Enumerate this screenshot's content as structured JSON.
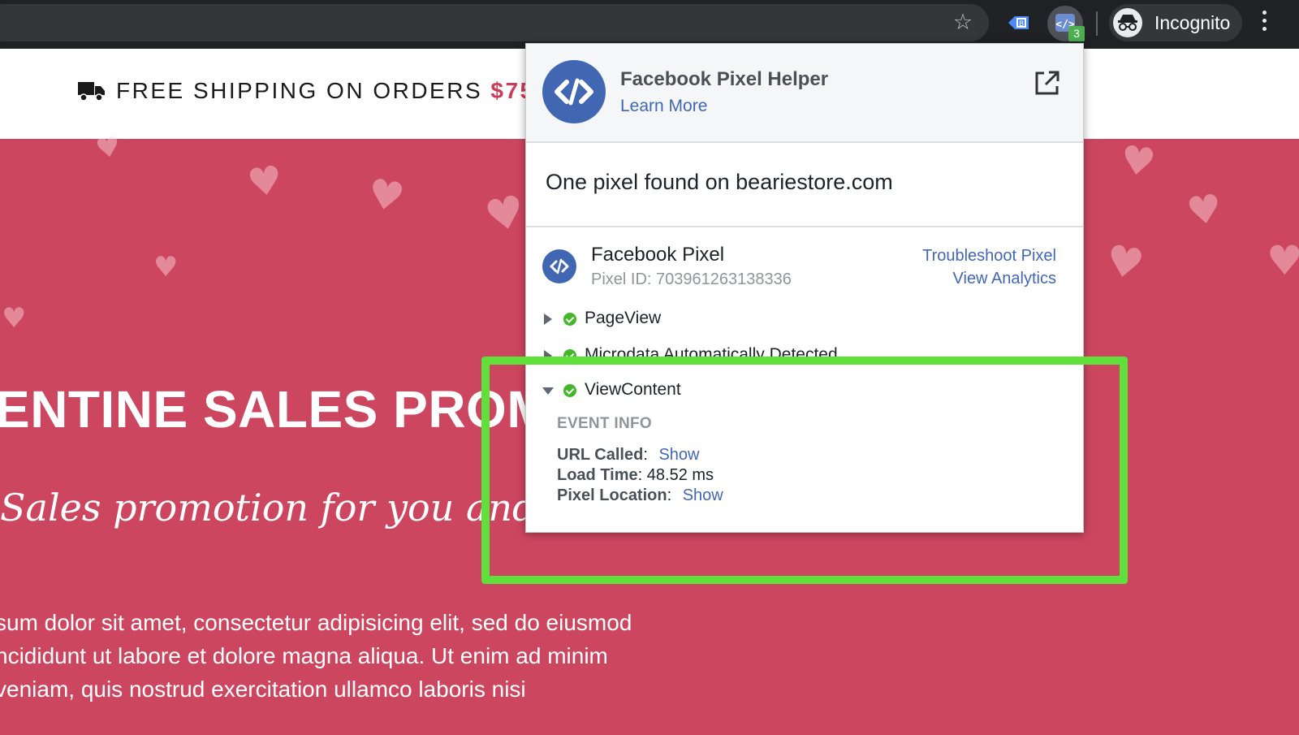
{
  "browser": {
    "star_icon": "star-icon",
    "extension_badge": "3",
    "profile_label": "Incognito"
  },
  "page": {
    "shipping": {
      "text": "FREE SHIPPING ON ORDERS",
      "price": "$75+"
    },
    "hero": {
      "title": "ENTINE SALES PROM",
      "script": "Sales promotion for you and your love",
      "body": [
        "sum dolor sit amet, consectetur adipisicing elit, sed do eiusmod",
        "ncididunt ut labore et dolore magna aliqua. Ut enim ad minim",
        "veniam, quis nostrud exercitation ullamco laboris nisi"
      ]
    }
  },
  "popup": {
    "title": "Facebook Pixel Helper",
    "learn_more": "Learn More",
    "found_text": "One pixel found on beariestore.com",
    "pixel": {
      "name": "Facebook Pixel",
      "id_text": "Pixel ID: 703961263138336",
      "troubleshoot": "Troubleshoot Pixel",
      "analytics": "View Analytics"
    },
    "events": [
      {
        "name": "PageView",
        "expanded": false
      },
      {
        "name": "Microdata Automatically Detected",
        "expanded": false
      },
      {
        "name": "ViewContent",
        "expanded": true
      }
    ],
    "event_info": {
      "heading": "EVENT INFO",
      "url_label": "URL Called",
      "url_link": "Show",
      "load_label": "Load Time",
      "load_value": "48.52 ms",
      "location_label": "Pixel Location",
      "location_link": "Show"
    }
  },
  "colors": {
    "brand_blue": "#4267b2",
    "hero_bg": "#cc4660",
    "highlight": "#5fe03a",
    "success": "#42b72a"
  }
}
